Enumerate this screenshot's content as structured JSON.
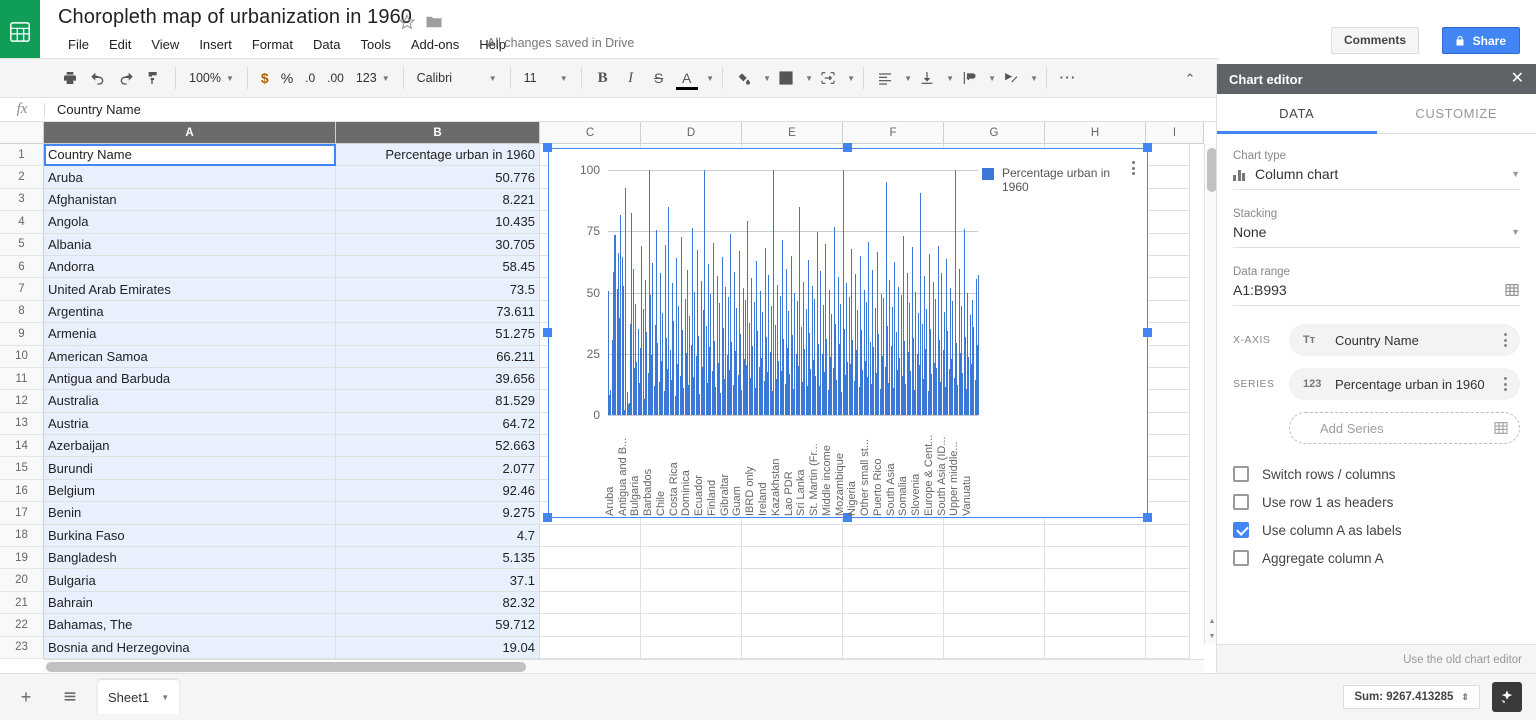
{
  "app": {
    "logo_icon": "sheets-logo-icon",
    "doc_title": "Choropleth map of urbanization in 1960",
    "save_state": "All changes saved in Drive",
    "comments_label": "Comments",
    "share_label": "Share",
    "accent_blue": "#4285f4",
    "brand_green": "#0f9d58"
  },
  "menubar": [
    "File",
    "Edit",
    "View",
    "Insert",
    "Format",
    "Data",
    "Tools",
    "Add-ons",
    "Help"
  ],
  "toolbar": {
    "zoom": "100%",
    "currency": "$",
    "percent": "%",
    "dec_less": ".0",
    "dec_more": ".00",
    "number_format": "123",
    "font": "Calibri",
    "font_size": "11",
    "bold": "B",
    "italic": "I",
    "strikethrough": "S",
    "text_color": "A"
  },
  "formula_bar": {
    "fx": "fx",
    "value": "Country Name"
  },
  "grid": {
    "columns": [
      "A",
      "B",
      "C",
      "D",
      "E",
      "F",
      "G",
      "H",
      "I"
    ],
    "headers": {
      "a": "Country Name",
      "b": "Percentage urban in 1960"
    },
    "rows": [
      {
        "n": "1",
        "a": "Country Name",
        "b": "Percentage urban in 1960"
      },
      {
        "n": "2",
        "a": "Aruba",
        "b": "50.776"
      },
      {
        "n": "3",
        "a": "Afghanistan",
        "b": "8.221"
      },
      {
        "n": "4",
        "a": "Angola",
        "b": "10.435"
      },
      {
        "n": "5",
        "a": "Albania",
        "b": "30.705"
      },
      {
        "n": "6",
        "a": "Andorra",
        "b": "58.45"
      },
      {
        "n": "7",
        "a": "United Arab Emirates",
        "b": "73.5"
      },
      {
        "n": "8",
        "a": "Argentina",
        "b": "73.611"
      },
      {
        "n": "9",
        "a": "Armenia",
        "b": "51.275"
      },
      {
        "n": "10",
        "a": "American Samoa",
        "b": "66.211"
      },
      {
        "n": "11",
        "a": "Antigua and Barbuda",
        "b": "39.656"
      },
      {
        "n": "12",
        "a": "Australia",
        "b": "81.529"
      },
      {
        "n": "13",
        "a": "Austria",
        "b": "64.72"
      },
      {
        "n": "14",
        "a": "Azerbaijan",
        "b": "52.663"
      },
      {
        "n": "15",
        "a": "Burundi",
        "b": "2.077"
      },
      {
        "n": "16",
        "a": "Belgium",
        "b": "92.46"
      },
      {
        "n": "17",
        "a": "Benin",
        "b": "9.275"
      },
      {
        "n": "18",
        "a": "Burkina Faso",
        "b": "4.7"
      },
      {
        "n": "19",
        "a": "Bangladesh",
        "b": "5.135"
      },
      {
        "n": "20",
        "a": "Bulgaria",
        "b": "37.1"
      },
      {
        "n": "21",
        "a": "Bahrain",
        "b": "82.32"
      },
      {
        "n": "22",
        "a": "Bahamas, The",
        "b": "59.712"
      },
      {
        "n": "23",
        "a": "Bosnia and Herzegovina",
        "b": "19.04"
      }
    ]
  },
  "chart_data": {
    "type": "bar",
    "title": "",
    "xlabel": "",
    "ylabel": "",
    "ylim": [
      0,
      100
    ],
    "yticks": [
      0,
      25,
      50,
      75,
      100
    ],
    "grid": true,
    "legend_position": "top-right",
    "series": [
      {
        "name": "Percentage urban in 1960"
      }
    ],
    "categories": [
      "Aruba",
      "Antigua and B...",
      "Bulgaria",
      "Barbados",
      "Chile",
      "Costa Rica",
      "Dominica",
      "Ecuador",
      "Finland",
      "Gibraltar",
      "Guam",
      "IBRD only",
      "Ireland",
      "Kazakhstan",
      "Lao PDR",
      "Sri Lanka",
      "St. Martin (Fr...",
      "Middle income",
      "Mozambique",
      "Nigeria",
      "Other small st...",
      "Puerto Rico",
      "South Asia",
      "Somalia",
      "Slovenia",
      "Europe & Cent...",
      "South Asia (ID...",
      "Upper middle...",
      "Vanuatu"
    ],
    "values": [
      50.8,
      8.2,
      10.4,
      30.7,
      58.5,
      73.5,
      73.6,
      51.3,
      66.2,
      39.7,
      81.5,
      64.7,
      52.7,
      2.1,
      92.5,
      9.3,
      4.7,
      5.1,
      37.1,
      82.3,
      59.7,
      19.0,
      45.5,
      21.7,
      35.2,
      12.9,
      27.4,
      68.8,
      43.1,
      6.4,
      55.3,
      33.8,
      17.2,
      100.0,
      48.9,
      24.6,
      62.1,
      11.8,
      36.9,
      75.4,
      29.3,
      13.5,
      57.8,
      22.1,
      41.6,
      9.8,
      69.2,
      31.4,
      18.7,
      85.0,
      26.5,
      14.2,
      53.7,
      38.4,
      7.9,
      63.9,
      20.8,
      44.3,
      16.1,
      72.6,
      34.7,
      10.9,
      47.2,
      25.3,
      59.1,
      12.4,
      40.5,
      28.6,
      76.3,
      15.7,
      50.2,
      23.9,
      67.4,
      32.1,
      8.6,
      54.8,
      19.5,
      42.7,
      100.0,
      36.2,
      13.1,
      61.5,
      27.8,
      49.4,
      17.9,
      70.1,
      30.2,
      11.5,
      56.6,
      21.3,
      45.8,
      9.1,
      64.3,
      35.5,
      14.8,
      52.1,
      24.4,
      48.0,
      18.3,
      73.9,
      29.7,
      12.2,
      58.3,
      26.1,
      43.5,
      16.5,
      66.8,
      33.2,
      10.1,
      51.7,
      22.8,
      47.1,
      20.4,
      79.0,
      37.6,
      15.2,
      55.9,
      28.1,
      46.3,
      11.2,
      62.7,
      34.1,
      19.8,
      50.5,
      23.2,
      41.9,
      13.7,
      68.2,
      31.8,
      17.4,
      57.1,
      25.7,
      44.6,
      9.6,
      100.0,
      36.7,
      14.5,
      53.2,
      21.9,
      48.6,
      18.1,
      71.5,
      30.9,
      12.7,
      59.8,
      27.2,
      42.4,
      16.8,
      65.1,
      32.5,
      10.6,
      49.9,
      24.8,
      46.7,
      20.1,
      85.0,
      35.9,
      13.4,
      54.4,
      26.8,
      43.1,
      11.9,
      63.4,
      33.6,
      18.9,
      52.8,
      22.5,
      47.5,
      15.9,
      74.8,
      29.1,
      12.0,
      58.7,
      25.1,
      44.9,
      17.6,
      69.7,
      31.2,
      10.4,
      50.9,
      23.6,
      41.2,
      19.2,
      76.9,
      37.1,
      14.1,
      56.2,
      28.9,
      45.2,
      9.4,
      100.0,
      35.1,
      16.3,
      53.9,
      21.6,
      48.2,
      20.7,
      67.9,
      30.5,
      13.9,
      57.5,
      26.4,
      42.9,
      11.6,
      64.9,
      34.5,
      18.5,
      51.2,
      22.2,
      46.1,
      15.4,
      70.8,
      29.9,
      12.5,
      59.3,
      27.6,
      43.8,
      17.1,
      66.4,
      32.9,
      10.8,
      49.2,
      24.1,
      47.8,
      19.6,
      95.0,
      36.4,
      13.2,
      55.1,
      28.3,
      44.1,
      11.1,
      62.3,
      33.9,
      18.2,
      52.4,
      23.4,
      48.9,
      16.0,
      73.2,
      30.1,
      12.8,
      58.1,
      25.9,
      45.6,
      17.8,
      68.6,
      31.6,
      10.2,
      50.1,
      24.9,
      41.5,
      20.3,
      90.5,
      37.3,
      14.7,
      56.8,
      27.1,
      43.4,
      9.9,
      65.6,
      35.3,
      16.6,
      54.1,
      21.1,
      47.3,
      19.1,
      69.1,
      30.7,
      13.6,
      57.9,
      26.6,
      42.2,
      11.4,
      63.7,
      34.3,
      18.8,
      51.9,
      22.7,
      46.5,
      15.1,
      100.0,
      29.5,
      12.3,
      59.6,
      25.5,
      44.4,
      17.3,
      76.1,
      31.9,
      10.7,
      49.6,
      23.8,
      40.9,
      20.9,
      46.9,
      36.1,
      14.3,
      55.6,
      28.7,
      57.0
    ],
    "legend_label": "Percentage urban in 1960",
    "color": "#3c78d8"
  },
  "chart_editor": {
    "title": "Chart editor",
    "close_icon": "close-icon",
    "tabs": [
      {
        "label": "DATA",
        "active": true
      },
      {
        "label": "CUSTOMIZE",
        "active": false
      }
    ],
    "chart_type_label": "Chart type",
    "chart_type_value": "Column chart",
    "stacking_label": "Stacking",
    "stacking_value": "None",
    "data_range_label": "Data range",
    "data_range_value": "A1:B993",
    "x_axis_label": "X-AXIS",
    "x_axis_value": "Country Name",
    "x_axis_type": "Tт",
    "series_label": "SERIES",
    "series_value": "Percentage urban in 1960",
    "series_type": "123",
    "add_series_label": "Add Series",
    "checkboxes": [
      {
        "label": "Switch rows / columns",
        "checked": false
      },
      {
        "label": "Use row 1 as headers",
        "checked": false
      },
      {
        "label": "Use column A as labels",
        "checked": true
      },
      {
        "label": "Aggregate column A",
        "checked": false
      }
    ],
    "footer_link": "Use the old chart editor"
  },
  "bottom": {
    "add_sheet_icon": "plus-icon",
    "all_sheets_icon": "list-icon",
    "sheet_name": "Sheet1",
    "sum_text": "Sum: 9267.413285",
    "explore_icon": "explore-icon"
  }
}
